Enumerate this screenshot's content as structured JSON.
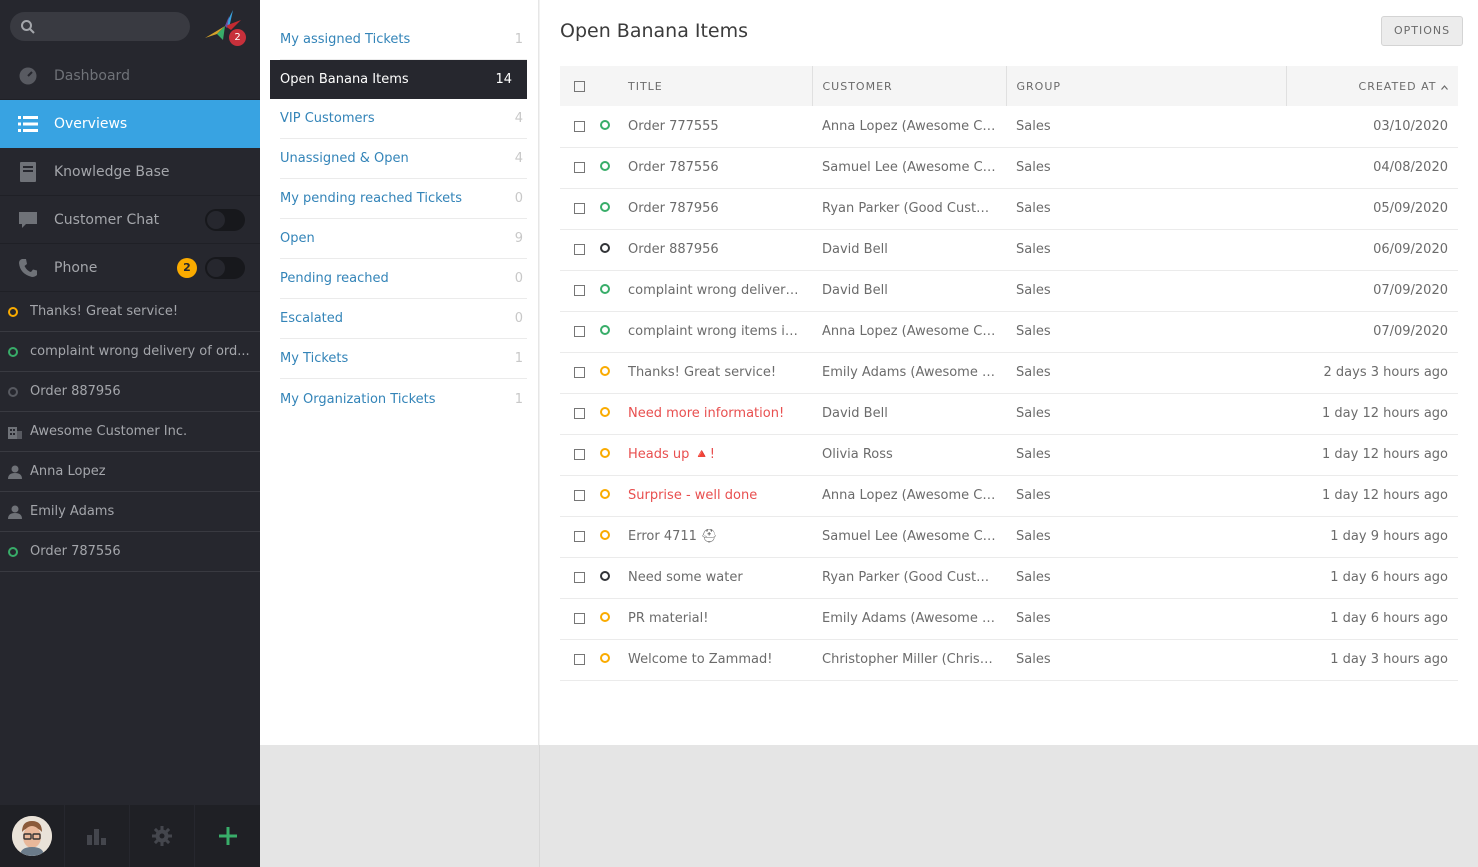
{
  "nav": {
    "search_placeholder": "",
    "logo_badge": "2",
    "menu": [
      {
        "label": "Dashboard",
        "icon": "dashboard-icon"
      },
      {
        "label": "Overviews",
        "icon": "list-icon"
      },
      {
        "label": "Knowledge Base",
        "icon": "book-icon"
      },
      {
        "label": "Customer Chat",
        "icon": "chat-icon"
      },
      {
        "label": "Phone",
        "icon": "phone-icon",
        "badge": "2"
      }
    ],
    "tasks": [
      {
        "label": "Thanks! Great service!",
        "icon": "ring-yellow"
      },
      {
        "label": "complaint wrong delivery of ord...",
        "icon": "ring-green"
      },
      {
        "label": "Order 887956",
        "icon": "ring-grey"
      },
      {
        "label": "Awesome Customer Inc.",
        "icon": "organization-icon"
      },
      {
        "label": "Anna Lopez",
        "icon": "person-icon"
      },
      {
        "label": "Emily Adams",
        "icon": "person-icon"
      },
      {
        "label": "Order 787556",
        "icon": "ring-green"
      }
    ]
  },
  "overviews": [
    {
      "label": "My assigned Tickets",
      "count": "1"
    },
    {
      "label": "Open Banana Items",
      "count": "14"
    },
    {
      "label": "VIP Customers",
      "count": "4"
    },
    {
      "label": "Unassigned & Open",
      "count": "4"
    },
    {
      "label": "My pending reached Tickets",
      "count": "0"
    },
    {
      "label": "Open",
      "count": "9"
    },
    {
      "label": "Pending reached",
      "count": "0"
    },
    {
      "label": "Escalated",
      "count": "0"
    },
    {
      "label": "My Tickets",
      "count": "1"
    },
    {
      "label": "My Organization Tickets",
      "count": "1"
    }
  ],
  "main": {
    "title": "Open Banana Items",
    "options_label": "OPTIONS",
    "columns": {
      "title": "TITLE",
      "customer": "CUSTOMER",
      "group": "GROUP",
      "created": "CREATED AT"
    },
    "tickets": [
      {
        "title": "Order 777555",
        "customer": "Anna Lopez (Awesome Cu...",
        "group": "Sales",
        "created": "03/10/2020",
        "state": "green",
        "urgent": false
      },
      {
        "title": "Order 787556",
        "customer": "Samuel Lee (Awesome Cu...",
        "group": "Sales",
        "created": "04/08/2020",
        "state": "green",
        "urgent": false
      },
      {
        "title": "Order 787956",
        "customer": "Ryan Parker (Good Custo...",
        "group": "Sales",
        "created": "05/09/2020",
        "state": "green",
        "urgent": false
      },
      {
        "title": "Order 887956",
        "customer": "David Bell",
        "group": "Sales",
        "created": "06/09/2020",
        "state": "dark",
        "urgent": false
      },
      {
        "title": "complaint wrong delivery...",
        "customer": "David Bell",
        "group": "Sales",
        "created": "07/09/2020",
        "state": "green",
        "urgent": false
      },
      {
        "title": "complaint wrong items in...",
        "customer": "Anna Lopez (Awesome Cu...",
        "group": "Sales",
        "created": "07/09/2020",
        "state": "green",
        "urgent": false
      },
      {
        "title": "Thanks! Great service!",
        "customer": "Emily Adams (Awesome C...",
        "group": "Sales",
        "created": "2 days 3 hours ago",
        "state": "yellow",
        "urgent": false
      },
      {
        "title": "Need more information!",
        "customer": "David Bell",
        "group": "Sales",
        "created": "1 day 12 hours ago",
        "state": "yellow",
        "urgent": true
      },
      {
        "title": "Heads up 🔺!",
        "customer": "Olivia Ross",
        "group": "Sales",
        "created": "1 day 12 hours ago",
        "state": "yellow",
        "urgent": true
      },
      {
        "title": "Surprise - well done",
        "customer": "Anna Lopez (Awesome Cu...",
        "group": "Sales",
        "created": "1 day 12 hours ago",
        "state": "yellow",
        "urgent": true
      },
      {
        "title": "Error 4711 ⛑",
        "customer": "Samuel Lee (Awesome Cu...",
        "group": "Sales",
        "created": "1 day 9 hours ago",
        "state": "yellow",
        "urgent": false
      },
      {
        "title": "Need some water",
        "customer": "Ryan Parker (Good Custo...",
        "group": "Sales",
        "created": "1 day 6 hours ago",
        "state": "dark",
        "urgent": false
      },
      {
        "title": "PR material!",
        "customer": "Emily Adams (Awesome C...",
        "group": "Sales",
        "created": "1 day 6 hours ago",
        "state": "yellow",
        "urgent": false
      },
      {
        "title": "Welcome to Zammad!",
        "customer": "Christopher Miller (Chrisp...",
        "group": "Sales",
        "created": "1 day 3 hours ago",
        "state": "yellow",
        "urgent": false
      }
    ]
  },
  "colors": {
    "accent": "#38a3e2",
    "nav_bg": "#26272e",
    "link": "#3384b8",
    "urgent": "#e84f4f",
    "state_green": "#38ad69",
    "state_yellow": "#faab00",
    "add_green": "#38ad69"
  }
}
